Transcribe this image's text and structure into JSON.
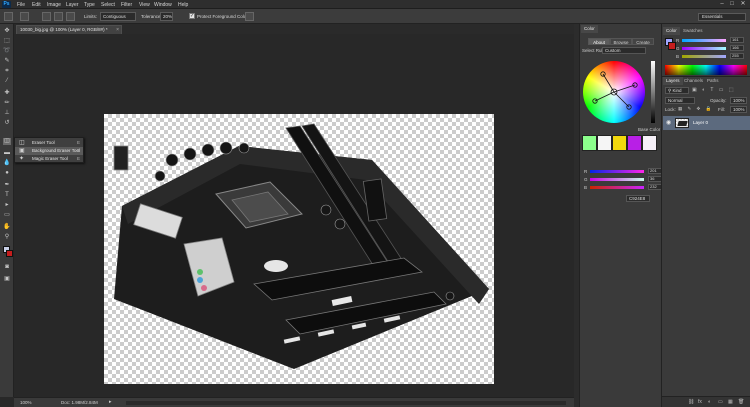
{
  "app": {
    "logo": "Ps"
  },
  "menu": [
    "File",
    "Edit",
    "Image",
    "Layer",
    "Type",
    "Select",
    "Filter",
    "View",
    "Window",
    "Help"
  ],
  "window_controls": [
    "–",
    "□",
    "✕"
  ],
  "options_bar": {
    "limits_label": "Limits:",
    "limits_value": "Contiguous",
    "tolerance_label": "Tolerance:",
    "tolerance_value": "20%",
    "protect_label": "Protect Foreground Color",
    "protect_checked": "✓"
  },
  "workspace": {
    "preset": "Essentials"
  },
  "document": {
    "tab_title": "10030_big.jpg @ 100% (Layer 0, RGB/8#) *",
    "close": "×"
  },
  "tool_flyout": {
    "items": [
      {
        "label": "Eraser Tool",
        "key": "E"
      },
      {
        "label": "Background Eraser Tool",
        "key": "E"
      },
      {
        "label": "Magic Eraser Tool",
        "key": "E"
      }
    ]
  },
  "status": {
    "zoom": "100%",
    "doc": "Doc: 1.98M/2.84M",
    "arrow": "▸"
  },
  "color_panel": {
    "tab": "Color",
    "subtabs": [
      "About",
      "Browse",
      "Create"
    ],
    "select_rule_label": "Select Rule:",
    "select_rule_value": "Custom",
    "base_color_label": "Base Color",
    "swatches": [
      "#8cff8c",
      "#f5f5f5",
      "#f2d80c",
      "#b81fe6",
      "#f5f0f8"
    ],
    "sliders": [
      {
        "label": "R",
        "value": "201"
      },
      {
        "label": "G",
        "value": "36"
      },
      {
        "label": "B",
        "value": "232"
      }
    ],
    "hex": "C924E8"
  },
  "right_panel": {
    "color_tabs": [
      "Color",
      "Swatches"
    ],
    "rgb_sliders": [
      {
        "label": "R",
        "value": "161"
      },
      {
        "label": "G",
        "value": "166"
      },
      {
        "label": "B",
        "value": "255"
      }
    ],
    "layer_tabs": [
      "Layers",
      "Channels",
      "Paths"
    ],
    "kind_label": "Kind",
    "blend_mode": "Normal",
    "opacity_label": "Opacity:",
    "opacity_value": "100%",
    "lock_label": "Lock:",
    "fill_label": "Fill:",
    "fill_value": "100%",
    "layers": [
      {
        "name": "Layer 0"
      }
    ],
    "bottom_icons": [
      "fx",
      "◐",
      "▭",
      "▦",
      "🗑"
    ]
  }
}
